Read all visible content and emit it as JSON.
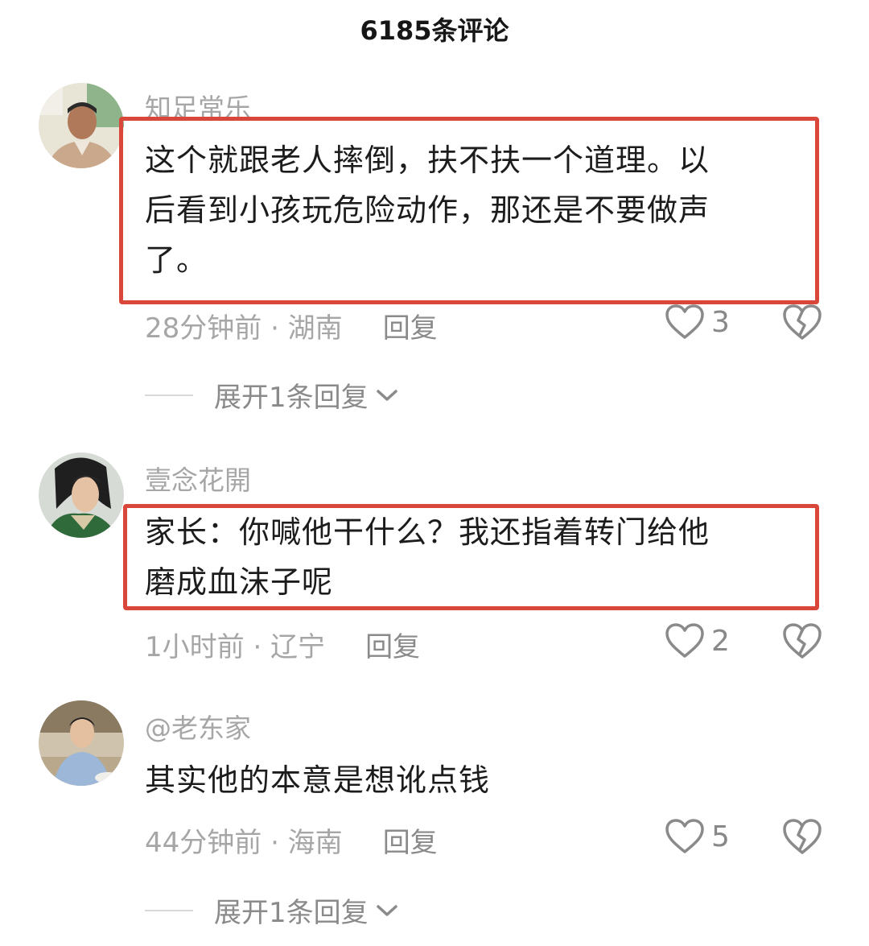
{
  "header": {
    "title": "6185条评论"
  },
  "comments": [
    {
      "username": "知足常乐",
      "lines": [
        "这个就跟老人摔倒，扶不扶一个道理。以",
        "后看到小孩玩危险动作，那还是不要做声",
        "了。"
      ],
      "time_location": "28分钟前 · 湖南",
      "reply_label": "回复",
      "likes": "3",
      "expand_label": "展开1条回复",
      "highlighted": true
    },
    {
      "username": "壹念花開",
      "lines": [
        "家长：你喊他干什么？我还指着转门给他",
        "磨成血沫子呢"
      ],
      "time_location": "1小时前 · 辽宁",
      "reply_label": "回复",
      "likes": "2",
      "highlighted": true
    },
    {
      "username": "@老东家",
      "lines": [
        "其实他的本意是想讹点钱"
      ],
      "time_location": "44分钟前 · 海南",
      "reply_label": "回复",
      "likes": "5",
      "expand_label": "展开1条回复",
      "highlighted": false
    }
  ],
  "colors": {
    "highlight_border": "#d9463a",
    "muted_text": "#a6a6a6"
  },
  "icons": {
    "like": "heart-outline-icon",
    "dislike": "broken-heart-icon",
    "expand": "chevron-down-icon"
  }
}
